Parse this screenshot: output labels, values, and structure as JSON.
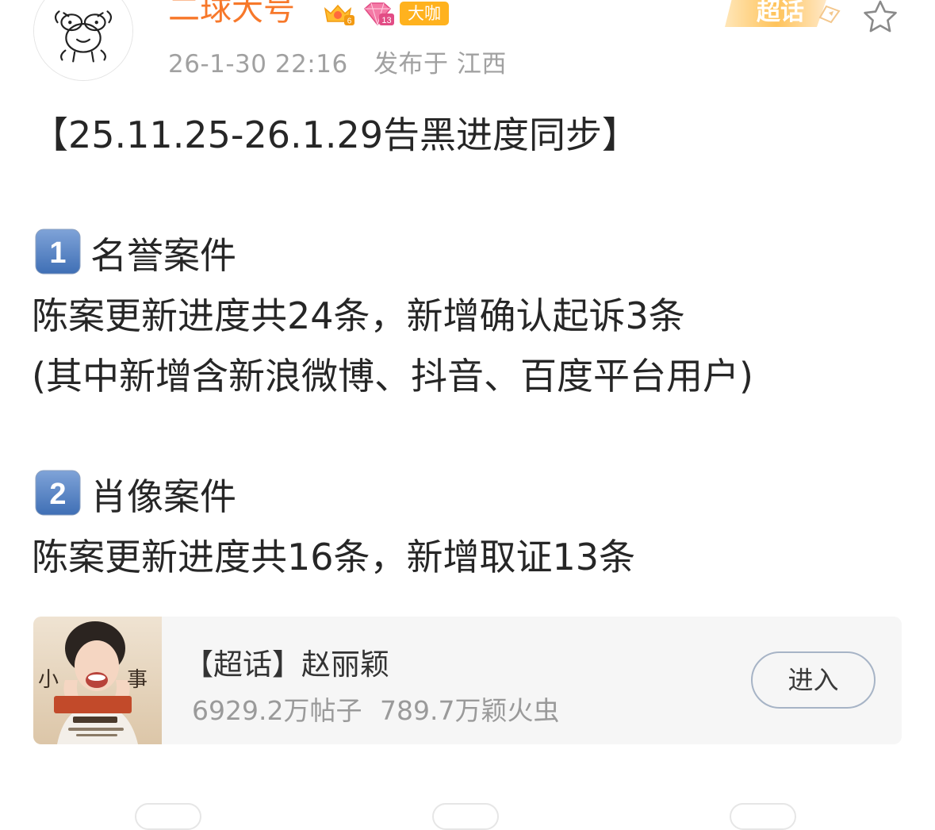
{
  "post": {
    "author": {
      "name": "二球大号",
      "avatar_icon": "cartoon-line-drawing-avatar",
      "badges": [
        {
          "icon": "vip-crown-badge-icon",
          "level": "6"
        },
        {
          "icon": "diamond-badge-icon",
          "level": "13"
        }
      ],
      "label_badge": "大咖"
    },
    "timestamp": "26-1-30 22:16",
    "location": "发布于 江西",
    "superchat_tag_label": "超话",
    "favorite_icon": "star-outline-icon",
    "content": {
      "heading": "【25.11.25-26.1.29告黑进度同步】",
      "section1": {
        "number_icon": "keycap-1-icon",
        "number": "1",
        "title": "名誉案件",
        "line1": "陈案更新进度共24条，新增确认起诉3条",
        "line2": "(其中新增含新浪微博、抖音、百度平台用户)"
      },
      "section2": {
        "number_icon": "keycap-2-icon",
        "number": "2",
        "title": "肖像案件",
        "line1": "陈案更新进度共16条，新增取证13条"
      }
    },
    "supertopic_card": {
      "thumbnail": "drama-poster-thumbnail",
      "title": "【超话】赵丽颖",
      "posts": "6929.2万帖子",
      "fans": "789.7万颖火虫",
      "enter_label": "进入"
    }
  },
  "colors": {
    "username": "#f7782a",
    "meta": "#a1a1a1",
    "badge_daka": "#ffb21e",
    "card_bg": "#f6f6f6",
    "enter_border": "#a7b4c6"
  }
}
